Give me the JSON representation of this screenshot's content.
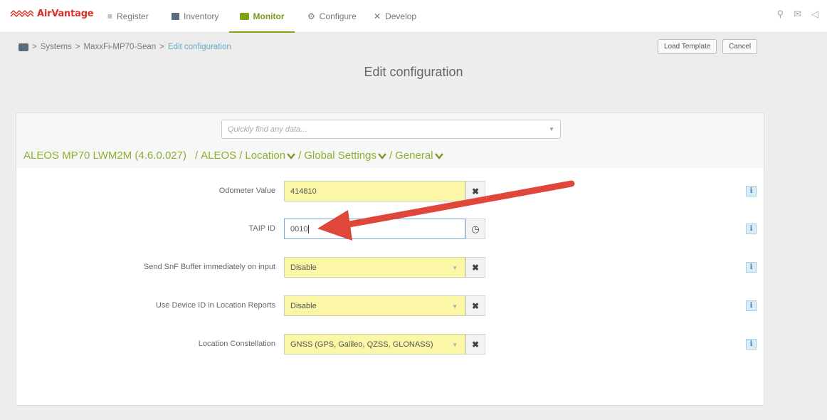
{
  "app": {
    "name": "AirVantage"
  },
  "nav": {
    "items": [
      {
        "label": "Register",
        "icon": "register-icon"
      },
      {
        "label": "Inventory",
        "icon": "inventory-icon"
      },
      {
        "label": "Monitor",
        "icon": "monitor-icon",
        "active": true
      },
      {
        "label": "Configure",
        "icon": "gear-icon"
      },
      {
        "label": "Develop",
        "icon": "tools-icon"
      }
    ],
    "right_icons": [
      "search-icon",
      "mail-icon",
      "megaphone-icon"
    ]
  },
  "breadcrumb": {
    "items": [
      "Systems",
      "MaxxFi-MP70-Sean",
      "Edit configuration"
    ],
    "separator": ">"
  },
  "toolbar": {
    "load_template": "Load Template",
    "cancel": "Cancel"
  },
  "page": {
    "title": "Edit configuration"
  },
  "search": {
    "placeholder": "Quickly find any data..."
  },
  "path": {
    "root": "ALEOS MP70 LWM2M (4.6.0.027)",
    "segments": [
      "ALEOS",
      "Location",
      "Global Settings",
      "General"
    ]
  },
  "fields": [
    {
      "label": "Odometer Value",
      "value": "414810",
      "type": "text",
      "action": "clear"
    },
    {
      "label": "TAIP ID",
      "value": "0010",
      "type": "text",
      "action": "clock"
    },
    {
      "label": "Send SnF Buffer immediately on input",
      "value": "Disable",
      "type": "select",
      "action": "clear"
    },
    {
      "label": "Use Device ID in Location Reports",
      "value": "Disable",
      "type": "select",
      "action": "clear"
    },
    {
      "label": "Location Constellation",
      "value": "GNSS (GPS, Galileo, QZSS, GLONASS)",
      "type": "select",
      "action": "clear"
    }
  ],
  "colors": {
    "accent": "#7fa418",
    "brand": "#d9322a",
    "field_highlight": "#fbf7a6",
    "annotation_arrow": "#e0473b"
  }
}
